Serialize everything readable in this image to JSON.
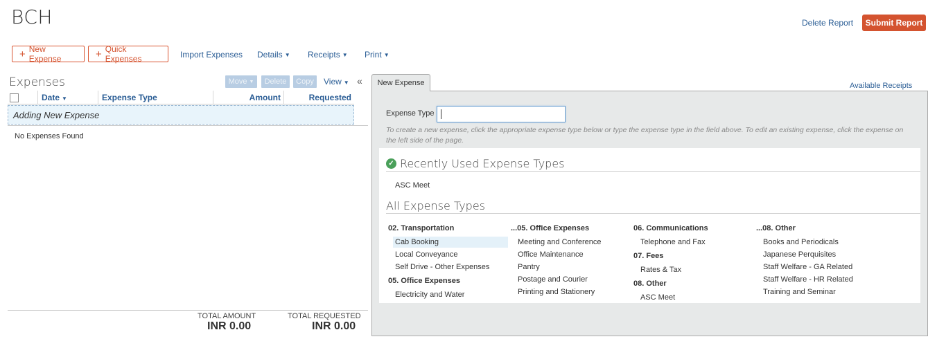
{
  "header": {
    "title": "BCH",
    "delete_label": "Delete Report",
    "submit_label": "Submit Report"
  },
  "toolbar": {
    "new_expense": "New Expense",
    "quick_expenses": "Quick Expenses",
    "import_expenses": "Import Expenses",
    "details": "Details",
    "receipts": "Receipts",
    "print": "Print"
  },
  "expenses_panel": {
    "title": "Expenses",
    "move": "Move",
    "delete": "Delete",
    "copy": "Copy",
    "view": "View",
    "collapse_glyph": "«",
    "columns": {
      "date": "Date",
      "expense_type": "Expense Type",
      "amount": "Amount",
      "requested": "Requested"
    },
    "adding_row": "Adding New Expense",
    "empty_text": "No Expenses Found",
    "total_amount_label": "TOTAL AMOUNT",
    "total_amount_value": "INR 0.00",
    "total_requested_label": "TOTAL REQUESTED",
    "total_requested_value": "INR 0.00"
  },
  "new_expense": {
    "tab_label": "New Expense",
    "available_receipts": "Available Receipts",
    "expense_type_label": "Expense Type",
    "hint": "To create a new expense, click the appropriate expense type below or type the expense type in the field above. To edit an existing expense, click the expense on the left side of the page.",
    "recent_title": "Recently Used Expense Types",
    "recent_items": [
      "ASC Meet"
    ],
    "all_title": "All Expense Types",
    "categories": {
      "c1": {
        "label": "02. Transportation",
        "items": [
          "Cab Booking",
          "Local Conveyance",
          "Self Drive - Other Expenses"
        ]
      },
      "c2": {
        "label": "05. Office Expenses",
        "items": [
          "Electricity and Water"
        ]
      },
      "c3": {
        "label": "...05. Office Expenses",
        "items": [
          "Meeting and Conference",
          "Office Maintenance",
          "Pantry",
          "Postage and Courier",
          "Printing and Stationery"
        ]
      },
      "c4": {
        "label": "06. Communications",
        "items": [
          "Telephone and Fax"
        ]
      },
      "c5": {
        "label": "07. Fees",
        "items": [
          "Rates & Tax"
        ]
      },
      "c6": {
        "label": "08. Other",
        "items": [
          "ASC Meet"
        ]
      },
      "c7": {
        "label": "...08. Other",
        "items": [
          "Books and Periodicals",
          "Japanese Perquisites",
          "Staff Welfare - GA Related",
          "Staff Welfare - HR Related",
          "Training and Seminar"
        ]
      }
    }
  },
  "colors": {
    "accent": "#d4532f",
    "link": "#2a5d95",
    "panel_bg": "#e7e9e9"
  }
}
